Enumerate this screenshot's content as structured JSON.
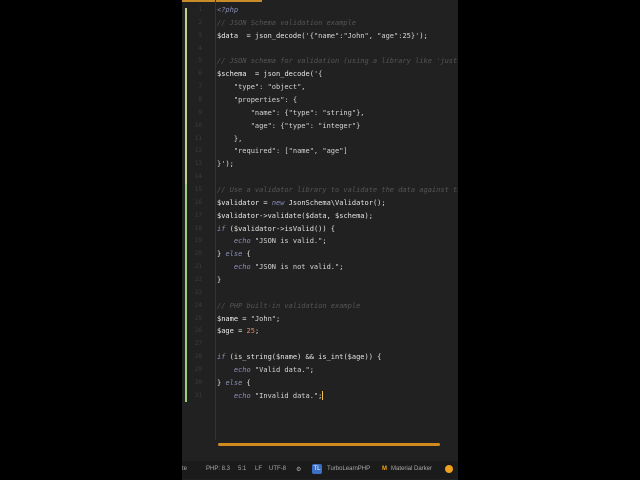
{
  "code": [
    [
      [
        "k",
        "<?php"
      ]
    ],
    [
      [
        "c",
        "// JSON Schema validation example"
      ]
    ],
    [
      [
        "v",
        "$data"
      ],
      [
        "",
        "  = json_decode("
      ],
      [
        "s",
        "'{\"name\":\"John\", \"age\":25}'"
      ],
      [
        "",
        ");"
      ]
    ],
    [],
    [
      [
        "c",
        "// JSON schema for validation (using a library like 'justinra"
      ]
    ],
    [
      [
        "v",
        "$schema"
      ],
      [
        "",
        ""
      ],
      [
        "",
        "  = json_decode("
      ],
      [
        "s",
        "'{"
      ]
    ],
    [
      [
        "s",
        "    \"type\": \"object\","
      ]
    ],
    [
      [
        "s",
        "    \"properties\": {"
      ]
    ],
    [
      [
        "s",
        "        \"name\": {\"type\": \"string\"},"
      ]
    ],
    [
      [
        "s",
        "        \"age\": {\"type\": \"integer\"}"
      ]
    ],
    [
      [
        "s",
        "    },"
      ]
    ],
    [
      [
        "s",
        "    \"required\": [\"name\", \"age\"]"
      ]
    ],
    [
      [
        "s",
        "}'"
      ],
      [
        "",
        ");"
      ]
    ],
    [],
    [
      [
        "c",
        "// Use a validator library to validate the data against the s"
      ]
    ],
    [
      [
        "v",
        "$validator"
      ],
      [
        "",
        " = "
      ],
      [
        "k",
        "new"
      ],
      [
        "",
        " JsonSchema\\Validator();"
      ]
    ],
    [
      [
        "v",
        "$validator"
      ],
      [
        "",
        "->validate($data, $schema);"
      ]
    ],
    [
      [
        "k",
        "if"
      ],
      [
        "",
        " ($validator->isValid()) {"
      ]
    ],
    [
      [
        "k",
        "    echo"
      ],
      [
        "s",
        " \"JSON is valid.\""
      ],
      [
        "",
        ";"
      ]
    ],
    [
      [
        "",
        "} "
      ],
      [
        "k",
        "else"
      ],
      [
        "",
        " {"
      ]
    ],
    [
      [
        "k",
        "    echo"
      ],
      [
        "s",
        " \"JSON is not valid.\""
      ],
      [
        "",
        ";"
      ]
    ],
    [
      [
        "",
        "}"
      ]
    ],
    [],
    [
      [
        "c",
        "// PHP built-in validation example"
      ]
    ],
    [
      [
        "v",
        "$name"
      ],
      [
        "",
        " = "
      ],
      [
        "s",
        "\"John\""
      ],
      [
        "",
        ";"
      ]
    ],
    [
      [
        "v",
        "$age"
      ],
      [
        "",
        " = "
      ],
      [
        "n",
        "25"
      ],
      [
        "",
        ";"
      ]
    ],
    [],
    [
      [
        "k",
        "if"
      ],
      [
        "",
        " (is_string($name) && is_int($age)) {"
      ]
    ],
    [
      [
        "k",
        "    echo"
      ],
      [
        "s",
        " \"Valid data.\""
      ],
      [
        "",
        ";"
      ]
    ],
    [
      [
        "",
        "} "
      ],
      [
        "k",
        "else"
      ],
      [
        "",
        " {"
      ]
    ],
    [
      [
        "k",
        "    echo"
      ],
      [
        "s",
        " \"Invalid data.\""
      ],
      [
        "",
        ";"
      ]
    ]
  ],
  "status": {
    "left": "te",
    "php": "PHP: 8.3",
    "pos": "5:1",
    "eol": "LF",
    "enc": "UTF-8",
    "tl_badge": "TL",
    "project": "TurboLearnPHP",
    "theme_icon": "M",
    "theme": "Material Darker"
  }
}
